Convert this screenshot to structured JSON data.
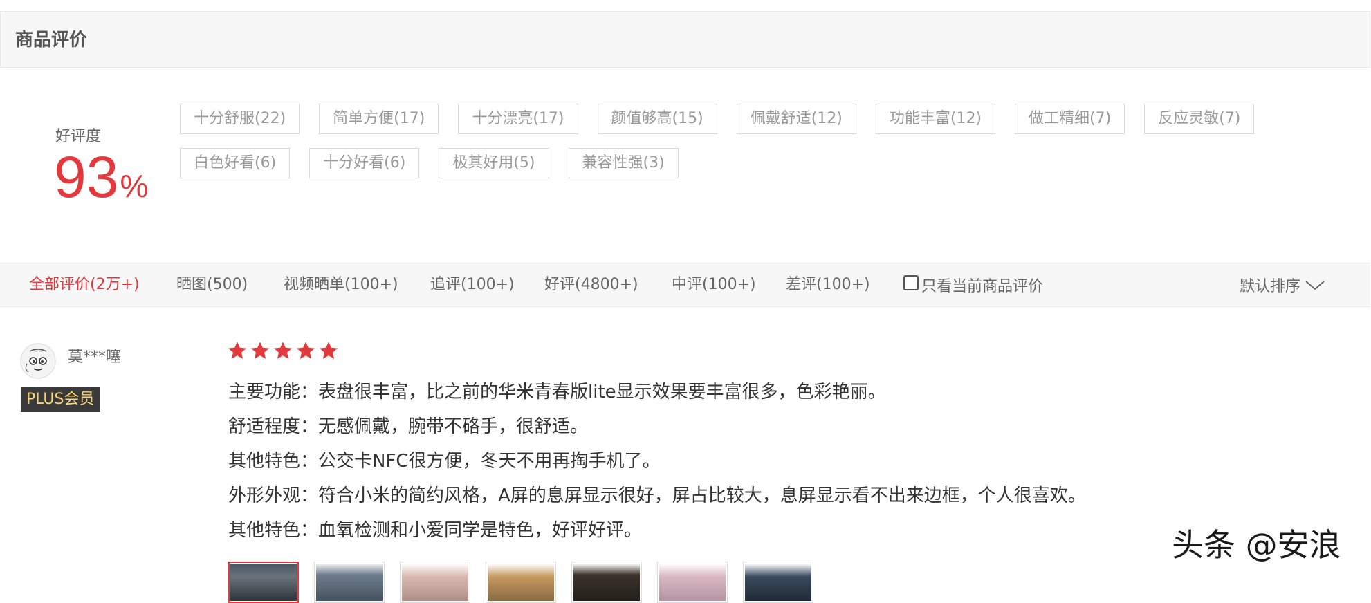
{
  "section": {
    "title": "商品评价"
  },
  "rating": {
    "label": "好评度",
    "value": "93",
    "unit": "%"
  },
  "tags": [
    "十分舒服(22)",
    "简单方便(17)",
    "十分漂亮(17)",
    "颜值够高(15)",
    "佩戴舒适(12)",
    "功能丰富(12)",
    "做工精细(7)",
    "反应灵敏(7)",
    "白色好看(6)",
    "十分好看(6)",
    "极其好用(5)",
    "兼容性强(3)"
  ],
  "filters": {
    "all": "全部评价(2万+)",
    "photos": "晒图(500)",
    "video": "视频晒单(100+)",
    "followup": "追评(100+)",
    "good": "好评(4800+)",
    "neutral": "中评(100+)",
    "bad": "差评(100+)",
    "current_only": "只看当前商品评价",
    "sort": "默认排序"
  },
  "review": {
    "username": "莫***噻",
    "badge": "PLUS会员",
    "stars": 5,
    "lines": [
      "主要功能：表盘很丰富，比之前的华米青春版lite显示效果要丰富很多，色彩艳丽。",
      "舒适程度：无感佩戴，腕带不硌手，很舒适。",
      "其他特色：公交卡NFC很方便，冬天不用再掏手机了。",
      "外形外观：符合小米的简约风格，A屏的息屏显示很好，屏占比较大，息屏显示看不出来边框，个人很喜欢。",
      "其他特色：血氧检测和小爱同学是特色，好评好评。"
    ]
  },
  "watermark": "头条 @安浪",
  "colors": {
    "accent": "#e4393c",
    "badge_bg": "#3a3a3a",
    "badge_text": "#f5d37c"
  },
  "icons": {
    "star": "star-icon",
    "sort": "chevron-down-icon",
    "avatar": "avatar-icon"
  }
}
